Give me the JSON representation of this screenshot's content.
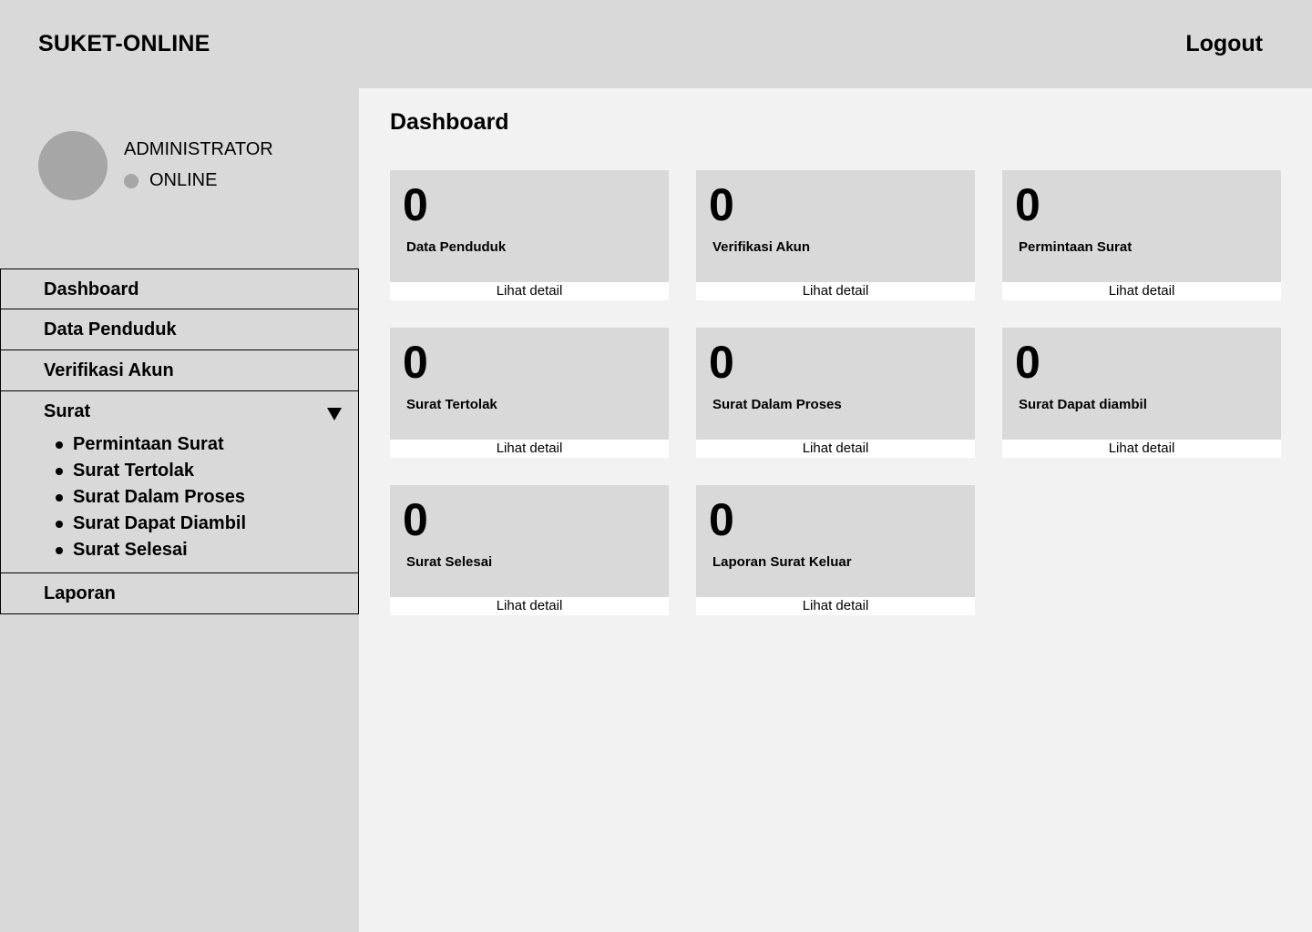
{
  "header": {
    "brand": "SUKET-ONLINE",
    "logout_label": "Logout"
  },
  "user": {
    "name": "ADMINISTRATOR",
    "status": "ONLINE"
  },
  "nav": {
    "dashboard": "Dashboard",
    "data_penduduk": "Data Penduduk",
    "verifikasi_akun": "Verifikasi Akun",
    "surat": {
      "label": "Surat",
      "items": [
        "Permintaan Surat",
        "Surat Tertolak",
        "Surat Dalam Proses",
        "Surat Dapat Diambil",
        "Surat Selesai"
      ]
    },
    "laporan": "Laporan"
  },
  "main": {
    "title": "Dashboard",
    "cards": [
      {
        "count": "0",
        "label": "Data Penduduk",
        "link": "Lihat detail"
      },
      {
        "count": "0",
        "label": "Verifikasi Akun",
        "link": "Lihat detail"
      },
      {
        "count": "0",
        "label": "Permintaan Surat",
        "link": "Lihat detail"
      },
      {
        "count": "0",
        "label": "Surat Tertolak",
        "link": "Lihat detail"
      },
      {
        "count": "0",
        "label": "Surat Dalam Proses",
        "link": "Lihat detail"
      },
      {
        "count": "0",
        "label": "Surat Dapat diambil",
        "link": "Lihat detail"
      },
      {
        "count": "0",
        "label": "Surat Selesai",
        "link": "Lihat detail"
      },
      {
        "count": "0",
        "label": "Laporan Surat Keluar",
        "link": "Lihat detail"
      }
    ]
  },
  "icons": {
    "surat_toggle": "triangle-down-icon",
    "avatar": "avatar",
    "status": "status-dot"
  },
  "colors": {
    "panel": "#d9d9d9",
    "background": "#f2f2f2",
    "avatar": "#a6a6a6",
    "link_bg": "#ffffff"
  }
}
